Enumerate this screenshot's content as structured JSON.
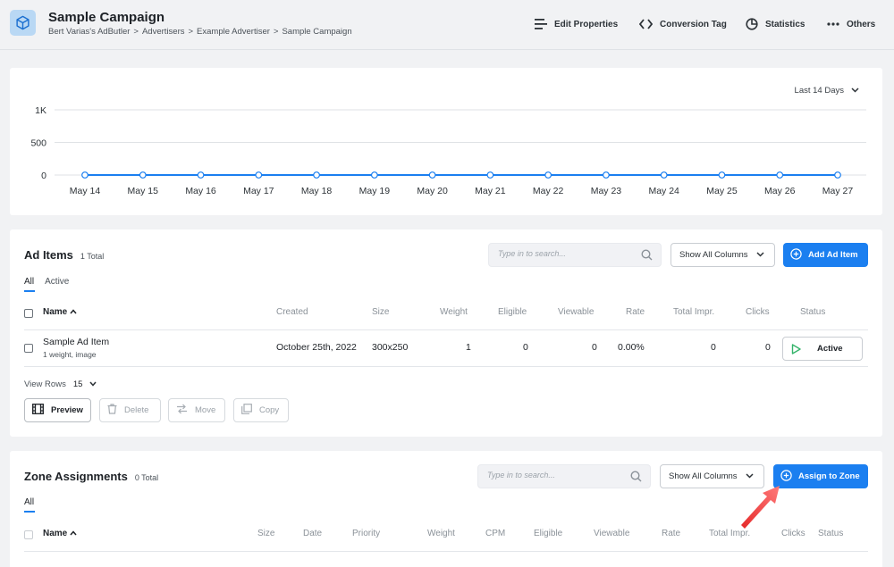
{
  "header": {
    "title": "Sample Campaign",
    "breadcrumb": [
      "Bert Varias's AdButler",
      "Advertisers",
      "Example Advertiser",
      "Sample Campaign"
    ],
    "breadcrumb_sep": ">",
    "actions": [
      {
        "label": "Edit Properties",
        "icon": "list-icon"
      },
      {
        "label": "Conversion Tag",
        "icon": "code-icon"
      },
      {
        "label": "Statistics",
        "icon": "pie-chart-icon"
      },
      {
        "label": "Others",
        "icon": "more-icon"
      }
    ]
  },
  "chart": {
    "range_label": "Last 14 Days",
    "accent": "#1b7ff0"
  },
  "chart_data": {
    "type": "line",
    "categories": [
      "May 14",
      "May 15",
      "May 16",
      "May 17",
      "May 18",
      "May 19",
      "May 20",
      "May 21",
      "May 22",
      "May 23",
      "May 24",
      "May 25",
      "May 26",
      "May 27"
    ],
    "values": [
      0,
      0,
      0,
      0,
      0,
      0,
      0,
      0,
      0,
      0,
      0,
      0,
      0,
      0
    ],
    "y_ticks": [
      "1K",
      "500",
      "0"
    ],
    "ylim": [
      0,
      1000
    ],
    "grid": true
  },
  "ad_items": {
    "title": "Ad Items",
    "count": "1 Total",
    "search_placeholder": "Type in to search...",
    "columns_button": "Show All Columns",
    "add_button": "Add Ad Item",
    "tabs": [
      "All",
      "Active"
    ],
    "columns": [
      "Name",
      "Created",
      "Size",
      "Weight",
      "Eligible",
      "Viewable",
      "Rate",
      "Total Impr.",
      "Clicks",
      "Status"
    ],
    "rows": [
      {
        "name": "Sample Ad Item",
        "sub": "1 weight, image",
        "created": "October 25th, 2022",
        "size": "300x250",
        "weight": "1",
        "eligible": "0",
        "viewable": "0",
        "rate": "0.00%",
        "total_impr": "0",
        "clicks": "0",
        "status": "Active"
      }
    ],
    "view_rows_label": "View Rows",
    "view_rows_value": "15",
    "actions": [
      {
        "label": "Preview",
        "enabled": true
      },
      {
        "label": "Delete",
        "enabled": false
      },
      {
        "label": "Move",
        "enabled": false
      },
      {
        "label": "Copy",
        "enabled": false
      }
    ]
  },
  "zone_assignments": {
    "title": "Zone Assignments",
    "count": "0 Total",
    "search_placeholder": "Type in to search...",
    "columns_button": "Show All Columns",
    "assign_button": "Assign to Zone",
    "tabs": [
      "All"
    ],
    "columns": [
      "Name",
      "Size",
      "Date",
      "Priority",
      "Weight",
      "CPM",
      "Eligible",
      "Viewable",
      "Rate",
      "Total Impr.",
      "Clicks",
      "Status"
    ]
  }
}
